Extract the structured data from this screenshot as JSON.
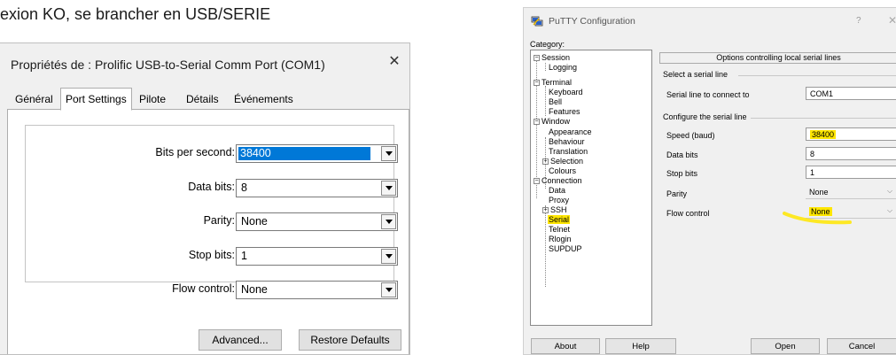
{
  "caption": "exion KO, se brancher en USB/SERIE",
  "colors": {
    "selection_blue": "#0078d7",
    "highlight_yellow": "#ffe600"
  },
  "win_dialog": {
    "title": "Propriétés de : Prolific USB-to-Serial Comm Port (COM1)",
    "close_icon": "close-icon",
    "tabs": [
      {
        "label": "Général"
      },
      {
        "label": "Port Settings",
        "active": true
      },
      {
        "label": "Pilote"
      },
      {
        "label": "Détails"
      },
      {
        "label": "Événements"
      }
    ],
    "fields": [
      {
        "label": "Bits per second:",
        "value": "38400"
      },
      {
        "label": "Data bits:",
        "value": "8"
      },
      {
        "label": "Parity:",
        "value": "None"
      },
      {
        "label": "Stop bits:",
        "value": "1"
      },
      {
        "label": "Flow control:",
        "value": "None"
      }
    ],
    "buttons": {
      "advanced": "Advanced...",
      "restore": "Restore Defaults"
    }
  },
  "putty": {
    "title": "PuTTY Configuration",
    "help_glyph": "?",
    "close_glyph": "✕",
    "category_label": "Category:",
    "tree": [
      {
        "label": "Session",
        "expander": "−"
      },
      {
        "label": "Logging"
      },
      {
        "label": "Terminal",
        "expander": "−"
      },
      {
        "label": "Keyboard"
      },
      {
        "label": "Bell"
      },
      {
        "label": "Features"
      },
      {
        "label": "Window",
        "expander": "−"
      },
      {
        "label": "Appearance"
      },
      {
        "label": "Behaviour"
      },
      {
        "label": "Translation"
      },
      {
        "label": "Selection",
        "expander": "+"
      },
      {
        "label": "Colours"
      },
      {
        "label": "Connection",
        "expander": "−"
      },
      {
        "label": "Data"
      },
      {
        "label": "Proxy"
      },
      {
        "label": "SSH",
        "expander": "+"
      },
      {
        "label": "Serial",
        "selected": true
      },
      {
        "label": "Telnet"
      },
      {
        "label": "Rlogin"
      },
      {
        "label": "SUPDUP"
      }
    ],
    "panel_title": "Options controlling local serial lines",
    "section1": "Select a serial line",
    "serial_line_label": "Serial line to connect to",
    "serial_line_value": "COM1",
    "section2": "Configure the serial line",
    "speed_label": "Speed (baud)",
    "speed_value": "38400",
    "databits_label": "Data bits",
    "databits_value": "8",
    "stopbits_label": "Stop bits",
    "stopbits_value": "1",
    "parity_label": "Parity",
    "parity_value": "None",
    "flow_label": "Flow control",
    "flow_value": "None",
    "buttons": {
      "about": "About",
      "help": "Help",
      "open": "Open",
      "cancel": "Cancel"
    }
  }
}
